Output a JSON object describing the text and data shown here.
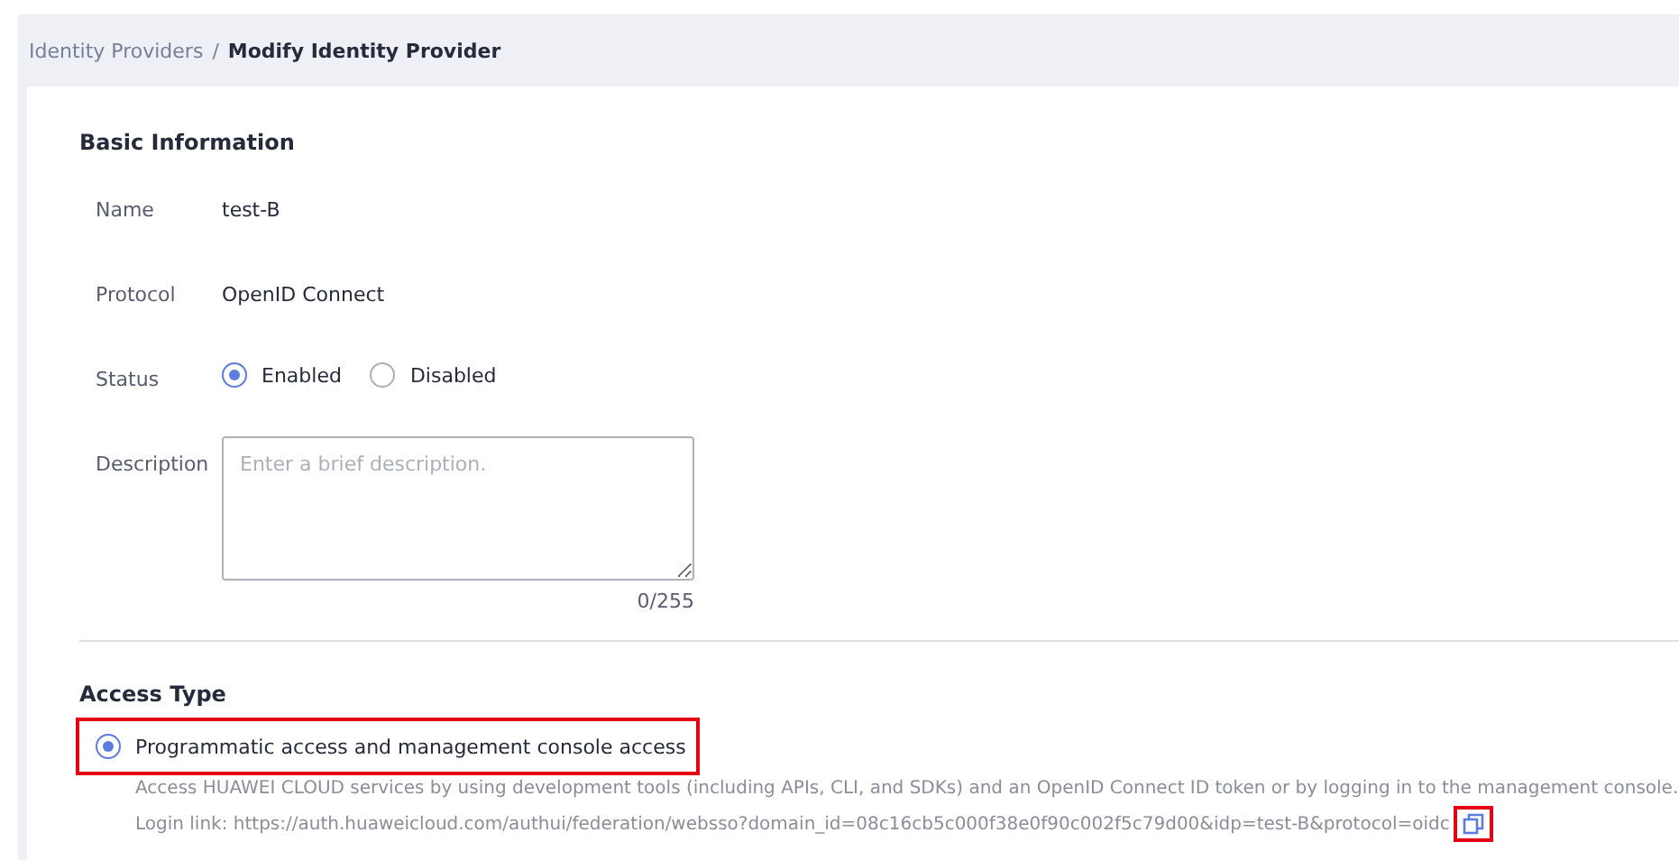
{
  "breadcrumb": {
    "parent": "Identity Providers",
    "separator": "/",
    "current": "Modify Identity Provider"
  },
  "basic_information": {
    "title": "Basic Information",
    "fields": [
      {
        "kind": "text",
        "label": "Name",
        "value": "test-B"
      },
      {
        "kind": "text",
        "label": "Protocol",
        "value": "OpenID Connect"
      },
      {
        "kind": "radio",
        "label": "Status",
        "options": [
          {
            "label": "Enabled",
            "selected": true
          },
          {
            "label": "Disabled",
            "selected": false
          }
        ]
      },
      {
        "kind": "textarea",
        "label": "Description",
        "placeholder": "Enter a brief description.",
        "counter": "0/255"
      }
    ]
  },
  "access_type": {
    "title": "Access Type",
    "options": [
      {
        "label": "Programmatic access and management console access",
        "selected": true,
        "highlighted": true,
        "description": "Access HUAWEI CLOUD services by using development tools (including APIs, CLI, and SDKs) and an OpenID Connect ID token or by logging in to the management console.",
        "login_link": "Login link: https://auth.huaweicloud.com/authui/federation/websso?domain_id=08c16cb5c000f38e0f90c002f5c79d00&idp=test-B&protocol=oidc",
        "copy_highlighted": true
      }
    ]
  }
}
